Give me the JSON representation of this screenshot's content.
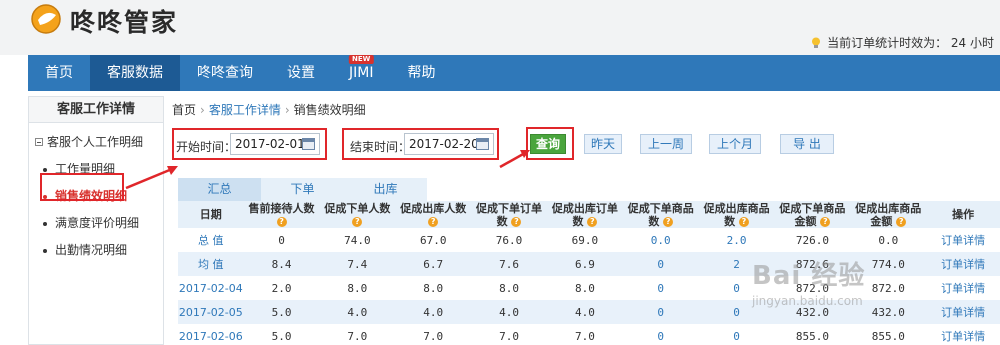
{
  "app": {
    "name": "咚咚管家"
  },
  "notice": {
    "text": "当前订单统计时效为： 24 小时"
  },
  "nav": [
    {
      "label": "首页"
    },
    {
      "label": "客服数据"
    },
    {
      "label": "咚咚查询"
    },
    {
      "label": "设置"
    },
    {
      "label": "JIMI",
      "badge": "NEW"
    },
    {
      "label": "帮助"
    }
  ],
  "sidebar": {
    "title": "客服工作详情",
    "group": "客服个人工作明细",
    "items": [
      {
        "label": "工作量明细"
      },
      {
        "label": "销售绩效明细"
      },
      {
        "label": "满意度评价明细"
      },
      {
        "label": "出勤情况明细"
      }
    ]
  },
  "breadcrumb": {
    "home": "首页",
    "parent": "客服工作详情",
    "current": "销售绩效明细"
  },
  "filter": {
    "start_label": "开始时间：",
    "start_value": "2017-02-01",
    "end_label": "结束时间：",
    "end_value": "2017-02-20"
  },
  "buttons": {
    "query": "查询",
    "yesterday": "昨天",
    "last_week": "上一周",
    "last_month": "上个月",
    "export": "导 出"
  },
  "tabs": [
    {
      "label": "汇总"
    },
    {
      "label": "下单"
    },
    {
      "label": "出库"
    }
  ],
  "table": {
    "headers": [
      "日期",
      "售前接待人数",
      "促成下单人数",
      "促成出库人数",
      "促成下单订单数",
      "促成出库订单数",
      "促成下单商品数",
      "促成出库商品数",
      "促成下单商品金额",
      "促成出库商品金额",
      "操作"
    ],
    "rows": [
      [
        "总 值",
        "0",
        "74.0",
        "67.0",
        "76.0",
        "69.0",
        "0.0",
        "2.0",
        "726.0",
        "0.0",
        "订单详情"
      ],
      [
        "均 值",
        "8.4",
        "7.4",
        "6.7",
        "7.6",
        "6.9",
        "0",
        "2",
        "872.6",
        "774.0",
        "订单详情"
      ],
      [
        "2017-02-04",
        "2.0",
        "8.0",
        "8.0",
        "8.0",
        "8.0",
        "0",
        "0",
        "872.0",
        "872.0",
        "订单详情"
      ],
      [
        "2017-02-05",
        "5.0",
        "4.0",
        "4.0",
        "4.0",
        "4.0",
        "0",
        "0",
        "432.0",
        "432.0",
        "订单详情"
      ],
      [
        "2017-02-06",
        "5.0",
        "7.0",
        "7.0",
        "7.0",
        "7.0",
        "0",
        "0",
        "855.0",
        "855.0",
        "订单详情"
      ]
    ]
  },
  "watermark": {
    "main": "Bai 经验",
    "sub": "jingyan.baidu.com"
  },
  "colors": {
    "nav": "#2f78b9",
    "nav_active": "#1d5a94",
    "highlight": "#e0262a",
    "query": "#4aa53d"
  }
}
